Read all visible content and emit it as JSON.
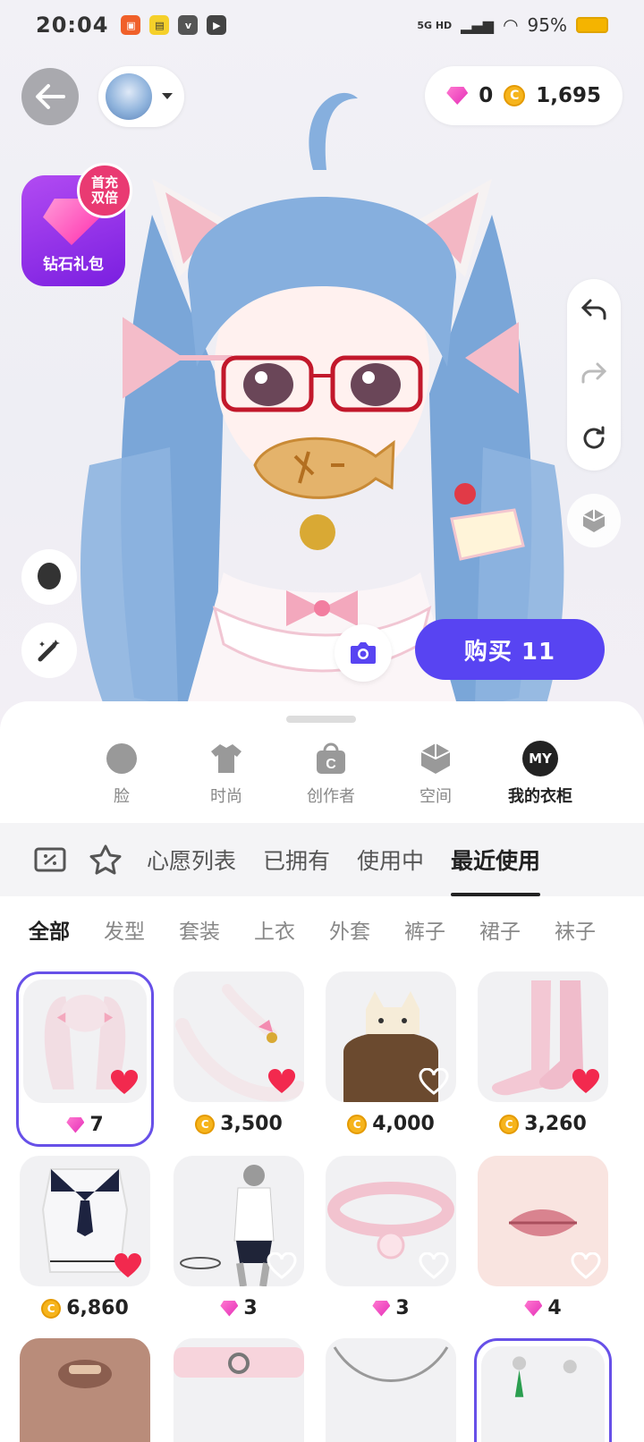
{
  "status": {
    "time": "20:04",
    "network": "5G HD",
    "battery": "95%"
  },
  "header": {
    "gems": "0",
    "coins": "1,695"
  },
  "gift_pack": {
    "label": "钻石礼包",
    "badge": "首充\n双倍"
  },
  "buy_button": "购买 11",
  "category_tabs": [
    {
      "label": "脸",
      "icon": "face-icon"
    },
    {
      "label": "时尚",
      "icon": "shirt-icon"
    },
    {
      "label": "创作者",
      "icon": "creator-bag-icon"
    },
    {
      "label": "空间",
      "icon": "space-cube-icon"
    },
    {
      "label": "我的衣柜",
      "icon": "my-closet-icon",
      "badge": "MY",
      "active": true
    }
  ],
  "filter_tabs": [
    {
      "label": "心愿列表"
    },
    {
      "label": "已拥有"
    },
    {
      "label": "使用中"
    },
    {
      "label": "最近使用",
      "active": true
    }
  ],
  "type_tabs": [
    "全部",
    "发型",
    "套装",
    "上衣",
    "外套",
    "裤子",
    "裙子",
    "袜子"
  ],
  "items": [
    {
      "currency": "gem",
      "price": "7",
      "favorited": true,
      "selected": true,
      "art": "hair"
    },
    {
      "currency": "coin",
      "price": "3,500",
      "favorited": true,
      "art": "tail"
    },
    {
      "currency": "coin",
      "price": "4,000",
      "favorited": false,
      "art": "cat-hat"
    },
    {
      "currency": "coin",
      "price": "3,260",
      "favorited": true,
      "art": "socks"
    },
    {
      "currency": "coin",
      "price": "6,860",
      "favorited": true,
      "art": "sailor-dress"
    },
    {
      "currency": "gem",
      "price": "3",
      "favorited": false,
      "art": "mannequin"
    },
    {
      "currency": "gem",
      "price": "3",
      "favorited": false,
      "art": "collar"
    },
    {
      "currency": "gem",
      "price": "4",
      "favorited": false,
      "art": "lips"
    },
    {
      "currency": "",
      "price": "",
      "favorited": false,
      "art": "face-partial"
    },
    {
      "currency": "",
      "price": "",
      "favorited": false,
      "art": "choker-partial"
    },
    {
      "currency": "",
      "price": "",
      "favorited": false,
      "art": "necklace-partial"
    },
    {
      "currency": "",
      "price": "",
      "favorited": false,
      "selected": true,
      "art": "earring-partial"
    }
  ],
  "colors": {
    "accent": "#5844f2",
    "heart": "#f2294e",
    "selected_border": "#6750e8"
  }
}
